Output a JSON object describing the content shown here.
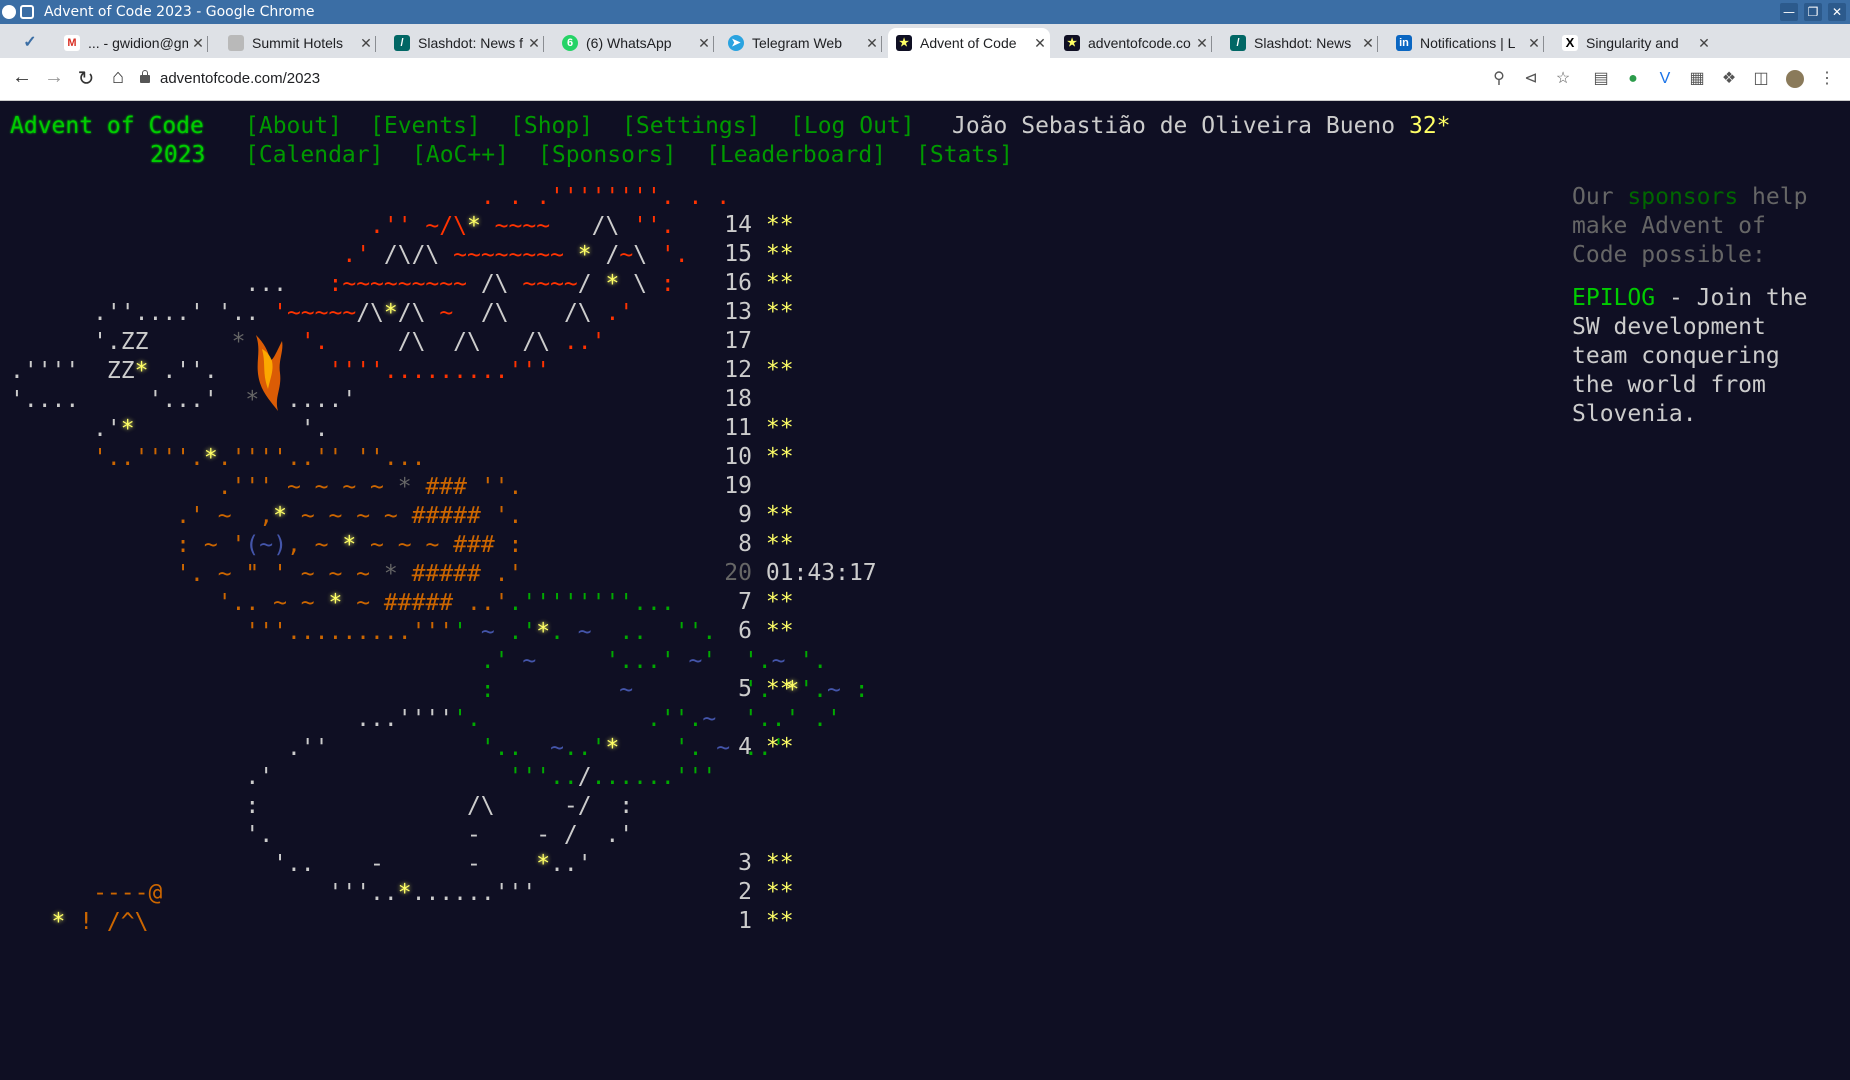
{
  "window": {
    "title": "Advent of Code 2023 - Google Chrome"
  },
  "tabs": [
    {
      "label": "... - gwidion@gm",
      "icon": "gmail-icon"
    },
    {
      "label": "Summit Hotels",
      "icon": "summit-icon"
    },
    {
      "label": "Slashdot: News f",
      "icon": "slashdot-icon"
    },
    {
      "label": "(6) WhatsApp",
      "icon": "whatsapp-icon"
    },
    {
      "label": "Telegram Web",
      "icon": "telegram-icon"
    },
    {
      "label": "Advent of Code",
      "icon": "aoc-icon",
      "active": true
    },
    {
      "label": "adventofcode.co",
      "icon": "aoc-icon"
    },
    {
      "label": "Slashdot: News",
      "icon": "slashdot-icon"
    },
    {
      "label": "Notifications | L",
      "icon": "linkedin-icon"
    },
    {
      "label": "Singularity and",
      "icon": "x-icon"
    }
  ],
  "address": {
    "url": "adventofcode.com/2023"
  },
  "header": {
    "title": "Advent of Code",
    "year": "2023",
    "links_row1": [
      "[About]",
      "[Events]",
      "[Shop]",
      "[Settings]",
      "[Log Out]"
    ],
    "links_row2": [
      "[Calendar]",
      "[AoC++]",
      "[Sponsors]",
      "[Leaderboard]",
      "[Stats]"
    ],
    "user": "João Sebastião de Oliveira Bueno",
    "star_count": "32*"
  },
  "calendar": [
    {
      "day": "14",
      "stars": "**"
    },
    {
      "day": "15",
      "stars": "**"
    },
    {
      "day": "16",
      "stars": "**"
    },
    {
      "day": "13",
      "stars": "**"
    },
    {
      "day": "17",
      "stars": ""
    },
    {
      "day": "12",
      "stars": "**"
    },
    {
      "day": "18",
      "stars": ""
    },
    {
      "day": "11",
      "stars": "**"
    },
    {
      "day": "10",
      "stars": "**"
    },
    {
      "day": "19",
      "stars": ""
    },
    {
      "day": "9",
      "stars": "**"
    },
    {
      "day": "8",
      "stars": "**"
    },
    {
      "day": "20",
      "stars": "",
      "countdown": "01:43:17"
    },
    {
      "day": "7",
      "stars": "**"
    },
    {
      "day": "6",
      "stars": "**"
    },
    {
      "day": "5",
      "stars": "**"
    },
    {
      "day": "4",
      "stars": "**"
    },
    {
      "day": "3",
      "stars": "**"
    },
    {
      "day": "2",
      "stars": "**"
    },
    {
      "day": "1",
      "stars": "**"
    }
  ],
  "sidebar": {
    "sponsor_line_pre": "Our",
    "sponsor_link": "sponsors",
    "sponsor_line_post": "help make Advent of Code possible:",
    "ad_name": "EPILOG",
    "ad_text": "- Join the SW development team conquering the world from Slovenia."
  },
  "colors": {
    "background": "#0f0f23",
    "link": "#009900",
    "star": "#ffff66",
    "title": "#00cc00"
  }
}
